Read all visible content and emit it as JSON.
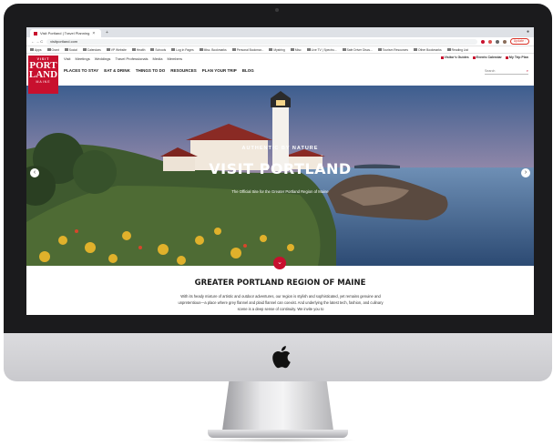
{
  "browser": {
    "tab_title": "Visit Portland | Travel Planning",
    "tab_close": "×",
    "new_tab": "+",
    "window_close": "●",
    "nav_buttons": "← → C",
    "url": "visitportland.com",
    "update_label": "Update :",
    "bookmarks": [
      "Apps",
      "Grant",
      "Social",
      "Calendars",
      "VP Website",
      "Health",
      "Schools",
      "Log In Pages",
      "Misc. Bookmarks",
      "Personal Bookmar...",
      "Mystring",
      "Misc",
      "Live TV | Spectru...",
      "Safe Driver Discs...",
      "Tourism Resources",
      "Other Bookmarks",
      "Reading List"
    ]
  },
  "site": {
    "logo": {
      "visit": "VISIT",
      "portland_1": "PORT",
      "portland_2": "LAND",
      "maine": "MAINE"
    },
    "utility_nav": [
      "Visit",
      "Meetings",
      "Weddings",
      "Travel Professionals",
      "Media",
      "Members"
    ],
    "cta_links": [
      "Visitor's Guides",
      "Events Calendar",
      "My Trip Plan"
    ],
    "main_nav": [
      "PLACES TO STAY",
      "EAT & DRINK",
      "THINGS TO DO",
      "RESOURCES",
      "PLAN YOUR TRIP",
      "BLOG"
    ],
    "search_placeholder": "Search",
    "brand_color": "#c8102e"
  },
  "hero": {
    "tagline": "AUTHENTIC BY NATURE",
    "title": "VISIT PORTLAND",
    "subtitle": "The Official Site for the Greater Portland Region of Maine",
    "prev_arrow": "‹",
    "next_arrow": "›",
    "scroll_down": "⌄"
  },
  "intro": {
    "title": "GREATER PORTLAND REGION OF MAINE",
    "body": "With its heady mixture of artistic and outdoor adventures, our region is stylish and sophisticated, yet remains genuine and unpretentious—a place where grey flannel and plaid flannel can coexist. And underlying the latest tech, fashion, and culinary scene is a deep sense of continuity. We invite you to"
  }
}
